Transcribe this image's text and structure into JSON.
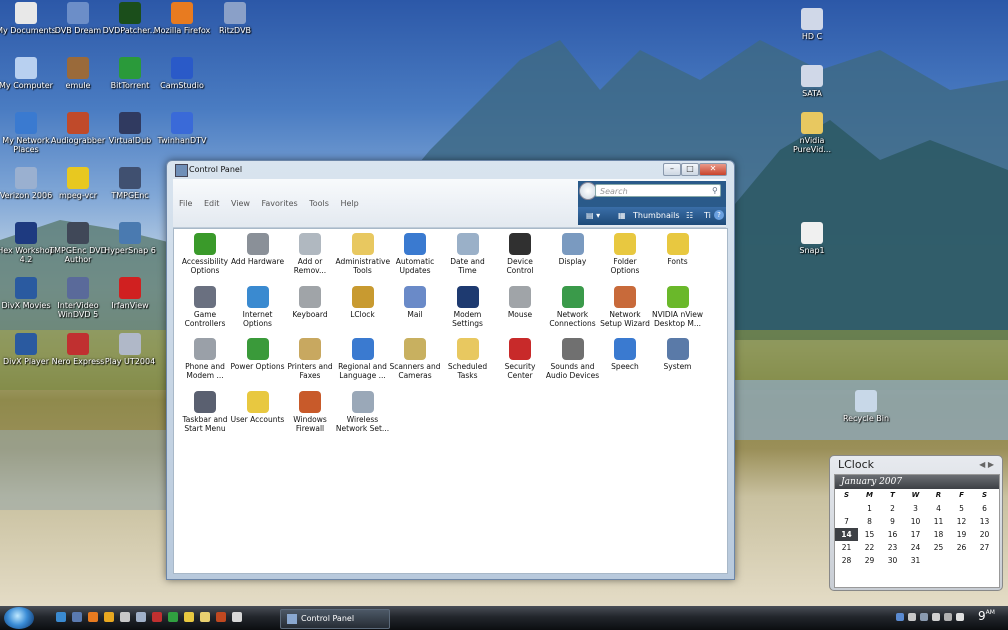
{
  "desktop": {
    "icons": [
      {
        "label": "My Documents",
        "color": "#e8e8e8"
      },
      {
        "label": "DVB Dream",
        "color": "#6c8ec8"
      },
      {
        "label": "DVDPatcher...",
        "color": "#1b4e1b"
      },
      {
        "label": "Mozilla Firefox",
        "color": "#e87b20"
      },
      {
        "label": "RitzDVB",
        "color": "#8aa0c8"
      },
      {
        "label": "My Computer",
        "color": "#b8d0f0"
      },
      {
        "label": "emule",
        "color": "#9a6a3a"
      },
      {
        "label": "BitTorrent",
        "color": "#2a9a3a"
      },
      {
        "label": "CamStudio",
        "color": "#2a5ac8"
      },
      {
        "label": "My Network Places",
        "color": "#3a7ad0"
      },
      {
        "label": "Audiograbber",
        "color": "#c04a2a"
      },
      {
        "label": "VirtualDub",
        "color": "#303a60"
      },
      {
        "label": "TwinhanDTV",
        "color": "#3a6ad8"
      },
      {
        "label": "Verizon 2006",
        "color": "#9ab0d0"
      },
      {
        "label": "mpeg-vcr",
        "color": "#e8c820"
      },
      {
        "label": "TMPGEnc",
        "color": "#405070"
      },
      {
        "label": "Hex Workshop 4.2",
        "color": "#1e3a80"
      },
      {
        "label": "TMPGEnc DVD Author",
        "color": "#404858"
      },
      {
        "label": "HyperSnap 6",
        "color": "#4a7ab0"
      },
      {
        "label": "DivX Movies",
        "color": "#2a5aa0"
      },
      {
        "label": "InterVideo WinDVD 5",
        "color": "#5a6a9a"
      },
      {
        "label": "IrfanView",
        "color": "#d02020"
      },
      {
        "label": "DivX Player",
        "color": "#2a5aa0"
      },
      {
        "label": "Nero Express",
        "color": "#c03030"
      },
      {
        "label": "Play UT2004",
        "color": "#b0b8c8"
      },
      {
        "label": "HD C",
        "color": "#d0d8e8"
      },
      {
        "label": "SATA",
        "color": "#d0d8e8"
      },
      {
        "label": "nVidia PureVid...",
        "color": "#e8c860"
      },
      {
        "label": "Snap1",
        "color": "#f0f0f0"
      },
      {
        "label": "Recycle Bin",
        "color": "#c8d8e8"
      }
    ]
  },
  "window": {
    "title": "Control Panel",
    "controls": {
      "minimize": "–",
      "maximize": "□",
      "close": "✕"
    },
    "menu": [
      "File",
      "Edit",
      "View",
      "Favorites",
      "Tools",
      "Help"
    ],
    "search_placeholder": "Search",
    "view_label": "Thumbnails",
    "view_extra": "Ti",
    "items": [
      {
        "label": "Accessibility Options",
        "icon": "accessibility-icon",
        "color": "#3a9a2a"
      },
      {
        "label": "Add Hardware",
        "icon": "hardware-icon",
        "color": "#8a9098"
      },
      {
        "label": "Add or Remov...",
        "icon": "add-remove-icon",
        "color": "#b0b8c0"
      },
      {
        "label": "Administrative Tools",
        "icon": "admin-tools-icon",
        "color": "#e8c860"
      },
      {
        "label": "Automatic Updates",
        "icon": "updates-icon",
        "color": "#3a7ad0"
      },
      {
        "label": "Date and Time",
        "icon": "clock-icon",
        "color": "#9ab0c8"
      },
      {
        "label": "Device Control",
        "icon": "device-icon",
        "color": "#303030"
      },
      {
        "label": "Display",
        "icon": "display-icon",
        "color": "#7a9ac0"
      },
      {
        "label": "Folder Options",
        "icon": "folder-icon",
        "color": "#e8c840"
      },
      {
        "label": "Fonts",
        "icon": "fonts-icon",
        "color": "#e8c840"
      },
      {
        "label": "Game Controllers",
        "icon": "gamepad-icon",
        "color": "#6a7080"
      },
      {
        "label": "Internet Options",
        "icon": "globe-icon",
        "color": "#3a8ad0"
      },
      {
        "label": "Keyboard",
        "icon": "keyboard-icon",
        "color": "#a0a4a8"
      },
      {
        "label": "LClock",
        "icon": "lclock-icon",
        "color": "#c89a30"
      },
      {
        "label": "Mail",
        "icon": "mail-icon",
        "color": "#6a8ac8"
      },
      {
        "label": "Modem Settings",
        "icon": "phone-icon",
        "color": "#1e3a70"
      },
      {
        "label": "Mouse",
        "icon": "mouse-icon",
        "color": "#a0a4a8"
      },
      {
        "label": "Network Connections",
        "icon": "network-icon",
        "color": "#3a9a4a"
      },
      {
        "label": "Network Setup Wizard",
        "icon": "network-wizard-icon",
        "color": "#c86a3a"
      },
      {
        "label": "NVIDIA nView Desktop M...",
        "icon": "nvidia-icon",
        "color": "#6ab82a"
      },
      {
        "label": "Phone and Modem ...",
        "icon": "phone-modem-icon",
        "color": "#9aa0a8"
      },
      {
        "label": "Power Options",
        "icon": "power-icon",
        "color": "#3a9a3a"
      },
      {
        "label": "Printers and Faxes",
        "icon": "printer-icon",
        "color": "#c8a860"
      },
      {
        "label": "Regional and Language ...",
        "icon": "regional-icon",
        "color": "#3a7ad0"
      },
      {
        "label": "Scanners and Cameras",
        "icon": "scanner-icon",
        "color": "#c8b060"
      },
      {
        "label": "Scheduled Tasks",
        "icon": "tasks-icon",
        "color": "#e8c860"
      },
      {
        "label": "Security Center",
        "icon": "shield-icon",
        "color": "#c82a2a"
      },
      {
        "label": "Sounds and Audio Devices",
        "icon": "speaker-icon",
        "color": "#707070"
      },
      {
        "label": "Speech",
        "icon": "speech-icon",
        "color": "#3a7ad0"
      },
      {
        "label": "System",
        "icon": "system-icon",
        "color": "#5a7aa8"
      },
      {
        "label": "Taskbar and Start Menu",
        "icon": "taskbar-icon",
        "color": "#5a6070"
      },
      {
        "label": "User Accounts",
        "icon": "users-icon",
        "color": "#e8c840"
      },
      {
        "label": "Windows Firewall",
        "icon": "firewall-icon",
        "color": "#c85a2a"
      },
      {
        "label": "Wireless Network Set...",
        "icon": "wireless-icon",
        "color": "#9aa8b8"
      }
    ]
  },
  "taskbar": {
    "task_label": "Control Panel",
    "clock": "9",
    "clock_ampm": "AM"
  },
  "lclock": {
    "title": "LClock",
    "nav": "◀ ▶",
    "month": "January 2007",
    "dow": [
      "S",
      "M",
      "T",
      "W",
      "R",
      "F",
      "S"
    ],
    "weeks": [
      [
        "",
        "1",
        "2",
        "3",
        "4",
        "5",
        "6"
      ],
      [
        "7",
        "8",
        "9",
        "10",
        "11",
        "12",
        "13"
      ],
      [
        "14",
        "15",
        "16",
        "17",
        "18",
        "19",
        "20"
      ],
      [
        "21",
        "22",
        "23",
        "24",
        "25",
        "26",
        "27"
      ],
      [
        "28",
        "29",
        "30",
        "31",
        "",
        "",
        ""
      ]
    ],
    "today": "14"
  }
}
